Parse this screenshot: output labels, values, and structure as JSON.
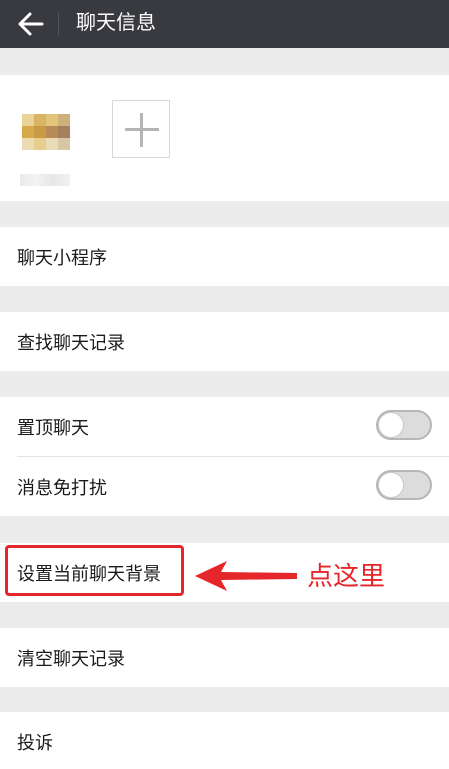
{
  "header": {
    "title": "聊天信息",
    "back_icon": "arrow-left-icon"
  },
  "members": {
    "add_icon": "plus-icon"
  },
  "menu": {
    "mini_programs": "聊天小程序",
    "search_history": "查找聊天记录",
    "pin_chat": "置顶聊天",
    "pin_chat_on": false,
    "mute": "消息免打扰",
    "mute_on": false,
    "set_background": "设置当前聊天背景",
    "clear_history": "清空聊天记录",
    "report": "投诉"
  },
  "annotation": {
    "text": "点这里",
    "color": "#e5262a"
  },
  "colors": {
    "topbar": "#393a3f",
    "background": "#ececec"
  }
}
